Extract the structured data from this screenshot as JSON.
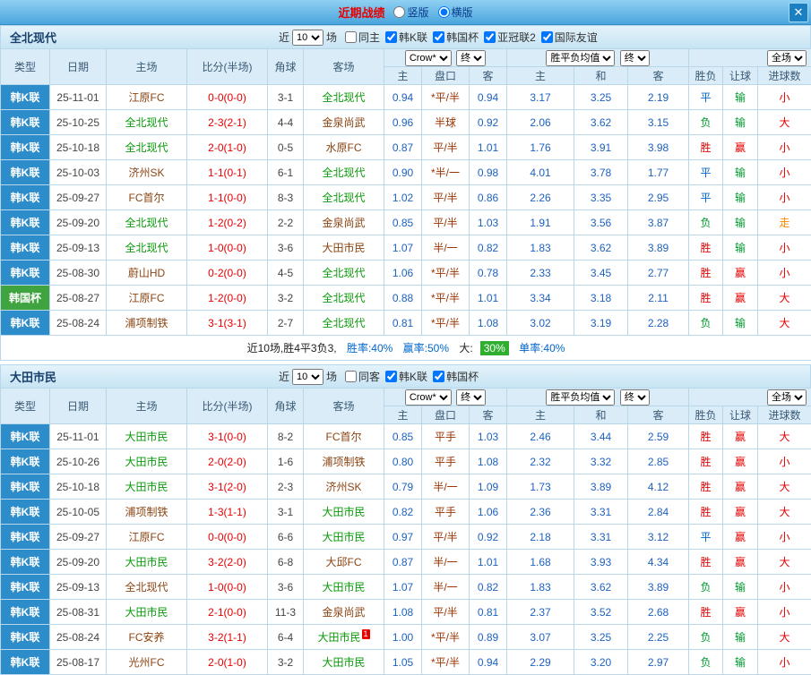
{
  "topbar": {
    "title": "近期战绩",
    "radio_vertical": "竖版",
    "radio_horizontal": "横版",
    "close": "✕"
  },
  "filter_labels": {
    "recent_pre": "近",
    "recent_post": "场"
  },
  "table_header": {
    "col_type": "类型",
    "col_date": "日期",
    "col_home": "主场",
    "col_score": "比分(半场)",
    "col_corner": "角球",
    "col_away": "客场",
    "odds_select1": "Crow*",
    "odds_select2": "终",
    "avg_select1": "胜平负均值",
    "avg_select2": "终",
    "scope_select": "全场",
    "sub_home": "主",
    "sub_handicap": "盘口",
    "sub_away": "客",
    "sub_avg_home": "主",
    "sub_draw": "和",
    "sub_avg_away": "客",
    "col_result": "胜负",
    "col_cover": "让球",
    "col_goals": "进球数"
  },
  "colors": {
    "league_blue": "#2d8dca",
    "cup_green": "#3fa33f",
    "win_red": "#e60000",
    "draw_blue": "#0066cc",
    "lose_green": "#00992e",
    "push_orange": "#ff8800"
  },
  "sections": [
    {
      "team": "全北现代",
      "filter": {
        "recent_value": "10",
        "checkboxes": [
          {
            "label": "同主",
            "checked": false
          },
          {
            "label": "韩K联",
            "checked": true
          },
          {
            "label": "韩国杯",
            "checked": true
          },
          {
            "label": "亚冠联2",
            "checked": true
          },
          {
            "label": "国际友谊",
            "checked": true
          }
        ]
      },
      "rows": [
        {
          "league": "韩K联",
          "lt": "k",
          "date": "25-11-01",
          "home": "江原FC",
          "hf": false,
          "score": "0-0(0-0)",
          "corner": "3-1",
          "away": "全北现代",
          "af": true,
          "o1": "0.94",
          "hcap": "*平/半",
          "o2": "0.94",
          "a1": "3.17",
          "a2": "3.25",
          "a3": "2.19",
          "res": "平",
          "cov": "输",
          "goal": "小"
        },
        {
          "league": "韩K联",
          "lt": "k",
          "date": "25-10-25",
          "home": "全北现代",
          "hf": true,
          "score": "2-3(2-1)",
          "corner": "4-4",
          "away": "金泉尚武",
          "af": false,
          "o1": "0.96",
          "hcap": "半球",
          "o2": "0.92",
          "a1": "2.06",
          "a2": "3.62",
          "a3": "3.15",
          "res": "负",
          "cov": "输",
          "goal": "大"
        },
        {
          "league": "韩K联",
          "lt": "k",
          "date": "25-10-18",
          "home": "全北现代",
          "hf": true,
          "score": "2-0(1-0)",
          "corner": "0-5",
          "away": "水原FC",
          "af": false,
          "o1": "0.87",
          "hcap": "平/半",
          "o2": "1.01",
          "a1": "1.76",
          "a2": "3.91",
          "a3": "3.98",
          "res": "胜",
          "cov": "赢",
          "goal": "小"
        },
        {
          "league": "韩K联",
          "lt": "k",
          "date": "25-10-03",
          "home": "济州SK",
          "hf": false,
          "score": "1-1(0-1)",
          "corner": "6-1",
          "away": "全北现代",
          "af": true,
          "o1": "0.90",
          "hcap": "*半/一",
          "o2": "0.98",
          "a1": "4.01",
          "a2": "3.78",
          "a3": "1.77",
          "res": "平",
          "cov": "输",
          "goal": "小"
        },
        {
          "league": "韩K联",
          "lt": "k",
          "date": "25-09-27",
          "home": "FC首尔",
          "hf": false,
          "score": "1-1(0-0)",
          "corner": "8-3",
          "away": "全北现代",
          "af": true,
          "o1": "1.02",
          "hcap": "平/半",
          "o2": "0.86",
          "a1": "2.26",
          "a2": "3.35",
          "a3": "2.95",
          "res": "平",
          "cov": "输",
          "goal": "小"
        },
        {
          "league": "韩K联",
          "lt": "k",
          "date": "25-09-20",
          "home": "全北现代",
          "hf": true,
          "score": "1-2(0-2)",
          "corner": "2-2",
          "away": "金泉尚武",
          "af": false,
          "o1": "0.85",
          "hcap": "平/半",
          "o2": "1.03",
          "a1": "1.91",
          "a2": "3.56",
          "a3": "3.87",
          "res": "负",
          "cov": "输",
          "goal": "走"
        },
        {
          "league": "韩K联",
          "lt": "k",
          "date": "25-09-13",
          "home": "全北现代",
          "hf": true,
          "score": "1-0(0-0)",
          "corner": "3-6",
          "away": "大田市民",
          "af": false,
          "o1": "1.07",
          "hcap": "半/一",
          "o2": "0.82",
          "a1": "1.83",
          "a2": "3.62",
          "a3": "3.89",
          "res": "胜",
          "cov": "输",
          "goal": "小"
        },
        {
          "league": "韩K联",
          "lt": "k",
          "date": "25-08-30",
          "home": "蔚山HD",
          "hf": false,
          "score": "0-2(0-0)",
          "corner": "4-5",
          "away": "全北现代",
          "af": true,
          "o1": "1.06",
          "hcap": "*平/半",
          "o2": "0.78",
          "a1": "2.33",
          "a2": "3.45",
          "a3": "2.77",
          "res": "胜",
          "cov": "赢",
          "goal": "小"
        },
        {
          "league": "韩国杯",
          "lt": "cup",
          "date": "25-08-27",
          "home": "江原FC",
          "hf": false,
          "score": "1-2(0-0)",
          "corner": "3-2",
          "away": "全北现代",
          "af": true,
          "o1": "0.88",
          "hcap": "*平/半",
          "o2": "1.01",
          "a1": "3.34",
          "a2": "3.18",
          "a3": "2.11",
          "res": "胜",
          "cov": "赢",
          "goal": "大"
        },
        {
          "league": "韩K联",
          "lt": "k",
          "date": "25-08-24",
          "home": "浦项制铁",
          "hf": false,
          "score": "3-1(3-1)",
          "corner": "2-7",
          "away": "全北现代",
          "af": true,
          "o1": "0.81",
          "hcap": "*平/半",
          "o2": "1.08",
          "a1": "3.02",
          "a2": "3.19",
          "a3": "2.28",
          "res": "负",
          "cov": "输",
          "goal": "大"
        }
      ],
      "summary": {
        "text": "近10场,胜4平3负3,",
        "win_rate": "胜率:40%",
        "cover_rate": "赢率:50%",
        "big_label": "大:",
        "big_value": "30%",
        "single_rate": "单率:40%"
      }
    },
    {
      "team": "大田市民",
      "filter": {
        "recent_value": "10",
        "checkboxes": [
          {
            "label": "同客",
            "checked": false
          },
          {
            "label": "韩K联",
            "checked": true
          },
          {
            "label": "韩国杯",
            "checked": true
          }
        ]
      },
      "rows": [
        {
          "league": "韩K联",
          "lt": "k",
          "date": "25-11-01",
          "home": "大田市民",
          "hf": true,
          "score": "3-1(0-0)",
          "corner": "8-2",
          "away": "FC首尔",
          "af": false,
          "o1": "0.85",
          "hcap": "平手",
          "o2": "1.03",
          "a1": "2.46",
          "a2": "3.44",
          "a3": "2.59",
          "res": "胜",
          "cov": "赢",
          "goal": "大"
        },
        {
          "league": "韩K联",
          "lt": "k",
          "date": "25-10-26",
          "home": "大田市民",
          "hf": true,
          "score": "2-0(2-0)",
          "corner": "1-6",
          "away": "浦项制铁",
          "af": false,
          "o1": "0.80",
          "hcap": "平手",
          "o2": "1.08",
          "a1": "2.32",
          "a2": "3.32",
          "a3": "2.85",
          "res": "胜",
          "cov": "赢",
          "goal": "小"
        },
        {
          "league": "韩K联",
          "lt": "k",
          "date": "25-10-18",
          "home": "大田市民",
          "hf": true,
          "score": "3-1(2-0)",
          "corner": "2-3",
          "away": "济州SK",
          "af": false,
          "o1": "0.79",
          "hcap": "半/一",
          "o2": "1.09",
          "a1": "1.73",
          "a2": "3.89",
          "a3": "4.12",
          "res": "胜",
          "cov": "赢",
          "goal": "大"
        },
        {
          "league": "韩K联",
          "lt": "k",
          "date": "25-10-05",
          "home": "浦项制铁",
          "hf": false,
          "score": "1-3(1-1)",
          "corner": "3-1",
          "away": "大田市民",
          "af": true,
          "o1": "0.82",
          "hcap": "平手",
          "o2": "1.06",
          "a1": "2.36",
          "a2": "3.31",
          "a3": "2.84",
          "res": "胜",
          "cov": "赢",
          "goal": "大"
        },
        {
          "league": "韩K联",
          "lt": "k",
          "date": "25-09-27",
          "home": "江原FC",
          "hf": false,
          "score": "0-0(0-0)",
          "corner": "6-6",
          "away": "大田市民",
          "af": true,
          "o1": "0.97",
          "hcap": "平/半",
          "o2": "0.92",
          "a1": "2.18",
          "a2": "3.31",
          "a3": "3.12",
          "res": "平",
          "cov": "赢",
          "goal": "小"
        },
        {
          "league": "韩K联",
          "lt": "k",
          "date": "25-09-20",
          "home": "大田市民",
          "hf": true,
          "score": "3-2(2-0)",
          "corner": "6-8",
          "away": "大邱FC",
          "af": false,
          "o1": "0.87",
          "hcap": "半/一",
          "o2": "1.01",
          "a1": "1.68",
          "a2": "3.93",
          "a3": "4.34",
          "res": "胜",
          "cov": "赢",
          "goal": "大"
        },
        {
          "league": "韩K联",
          "lt": "k",
          "date": "25-09-13",
          "home": "全北现代",
          "hf": false,
          "score": "1-0(0-0)",
          "corner": "3-6",
          "away": "大田市民",
          "af": true,
          "o1": "1.07",
          "hcap": "半/一",
          "o2": "0.82",
          "a1": "1.83",
          "a2": "3.62",
          "a3": "3.89",
          "res": "负",
          "cov": "输",
          "goal": "小"
        },
        {
          "league": "韩K联",
          "lt": "k",
          "date": "25-08-31",
          "home": "大田市民",
          "hf": true,
          "score": "2-1(0-0)",
          "corner": "11-3",
          "away": "金泉尚武",
          "af": false,
          "o1": "1.08",
          "hcap": "平/半",
          "o2": "0.81",
          "a1": "2.37",
          "a2": "3.52",
          "a3": "2.68",
          "res": "胜",
          "cov": "赢",
          "goal": "小"
        },
        {
          "league": "韩K联",
          "lt": "k",
          "date": "25-08-24",
          "home": "FC安养",
          "hf": false,
          "score": "3-2(1-1)",
          "corner": "6-4",
          "away": "大田市民",
          "af": true,
          "red": "1",
          "o1": "1.00",
          "hcap": "*平/半",
          "o2": "0.89",
          "a1": "3.07",
          "a2": "3.25",
          "a3": "2.25",
          "res": "负",
          "cov": "输",
          "goal": "大"
        },
        {
          "league": "韩K联",
          "lt": "k",
          "date": "25-08-17",
          "home": "光州FC",
          "hf": false,
          "score": "2-0(1-0)",
          "corner": "3-2",
          "away": "大田市民",
          "af": true,
          "o1": "1.05",
          "hcap": "*平/半",
          "o2": "0.94",
          "a1": "2.29",
          "a2": "3.20",
          "a3": "2.97",
          "res": "负",
          "cov": "输",
          "goal": "小"
        }
      ],
      "summary": null
    }
  ]
}
